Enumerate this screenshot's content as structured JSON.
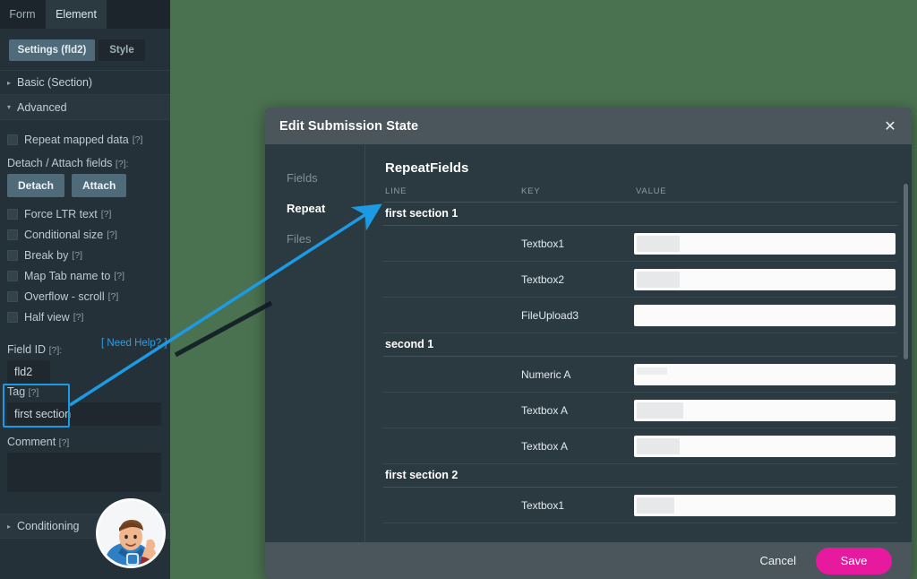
{
  "colors": {
    "page_background": "#4a7150",
    "panel_background": "#253138",
    "modal_background": "#2b3940",
    "modal_bar": "#4a555c",
    "accent_pink": "#e6199f",
    "accent_blue": "#1d9ae4",
    "link_blue": "#2f9fe0"
  },
  "sidebar": {
    "tabs": [
      {
        "label": "Form",
        "active": false
      },
      {
        "label": "Element",
        "active": true
      }
    ],
    "subtabs": [
      {
        "label": "Settings (fld2)",
        "active": true
      },
      {
        "label": "Style",
        "active": false
      }
    ],
    "sections": [
      {
        "label": "Basic (Section)",
        "expanded": false
      },
      {
        "label": "Advanced",
        "expanded": true
      },
      {
        "label": "Conditioning",
        "expanded": false
      }
    ],
    "checkboxes": [
      {
        "label": "Repeat mapped data",
        "hint": "[?]",
        "checked": false
      },
      {
        "label": "Force LTR text",
        "hint": "[?]",
        "checked": false
      },
      {
        "label": "Conditional size",
        "hint": "[?]",
        "checked": false
      },
      {
        "label": "Break by",
        "hint": "[?]",
        "checked": false
      },
      {
        "label": "Map Tab name to",
        "hint": "[?]",
        "checked": false
      },
      {
        "label": "Overflow - scroll",
        "hint": "[?]",
        "checked": false
      },
      {
        "label": "Half view",
        "hint": "[?]",
        "checked": false
      }
    ],
    "detach_attach": {
      "label": "Detach / Attach fields",
      "hint": "[?]:",
      "detach_label": "Detach",
      "attach_label": "Attach"
    },
    "field_id": {
      "label": "Field ID",
      "hint": "[?]:",
      "value": "fld2"
    },
    "tag": {
      "label": "Tag",
      "hint": "[?]",
      "value": "first section"
    },
    "comment": {
      "label": "Comment",
      "hint": "[?]",
      "value": ""
    },
    "need_help": "[ Need Help? ]",
    "mascot": "superhero-mascot-avatar"
  },
  "modal": {
    "title": "Edit Submission State",
    "close_icon": "close-icon",
    "nav": [
      {
        "label": "Fields",
        "active": false
      },
      {
        "label": "Repeat",
        "active": true
      },
      {
        "label": "Files",
        "active": false
      }
    ],
    "content_title": "RepeatFields",
    "columns": {
      "line": "LINE",
      "key": "KEY",
      "value": "VALUE"
    },
    "rows": [
      {
        "type": "section",
        "line": "first section 1"
      },
      {
        "type": "field",
        "key": "Textbox1",
        "value": "",
        "redaction": "w-md"
      },
      {
        "type": "field",
        "key": "Textbox2",
        "value": "",
        "redaction": "w-md"
      },
      {
        "type": "field",
        "key": "FileUpload3",
        "value": "",
        "redaction": "w-none"
      },
      {
        "type": "section",
        "line": "second 1"
      },
      {
        "type": "field",
        "key": "Numeric A",
        "value": "",
        "redaction": "w-xs"
      },
      {
        "type": "field",
        "key": "Textbox A",
        "value": "",
        "redaction": "w-lg"
      },
      {
        "type": "field",
        "key": "Textbox A",
        "value": "",
        "redaction": "w-md"
      },
      {
        "type": "section",
        "line": "first section 2"
      },
      {
        "type": "field",
        "key": "Textbox1",
        "value": "",
        "redaction": "w-sm"
      }
    ],
    "footer": {
      "cancel_label": "Cancel",
      "save_label": "Save"
    }
  },
  "annotation": {
    "arrow": "blue-arrow-from-tag-to-first-section-1",
    "highlight": "blue-box-around-tag-field"
  }
}
